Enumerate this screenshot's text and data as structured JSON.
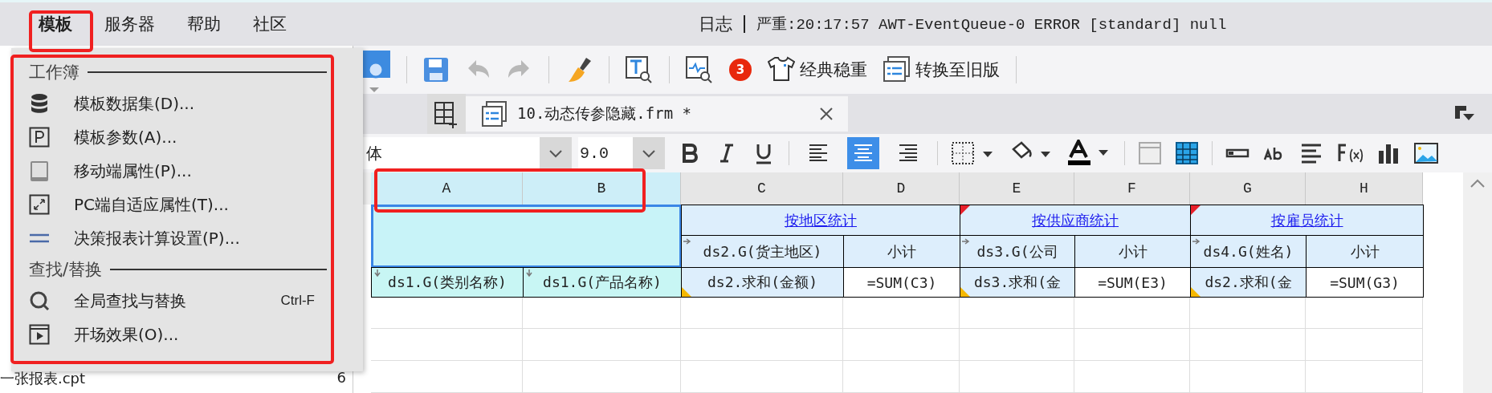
{
  "menubar": {
    "items": [
      {
        "label": "模板",
        "selected": true
      },
      {
        "label": "服务器",
        "selected": false
      },
      {
        "label": "帮助",
        "selected": false
      },
      {
        "label": "社区",
        "selected": false
      }
    ],
    "log_label": "日志",
    "log_text": "严重:20:17:57 AWT-EventQueue-0 ERROR [standard] null"
  },
  "menu": {
    "sections": [
      {
        "title": "工作簿",
        "items": [
          {
            "kind": "database",
            "label": "模板数据集(D)..."
          },
          {
            "kind": "param",
            "label": "模板参数(A)..."
          },
          {
            "kind": "tablet",
            "label": "移动端属性(P)..."
          },
          {
            "kind": "resize",
            "label": "PC端自适应属性(T)..."
          },
          {
            "kind": "lines",
            "label": "决策报表计算设置(P)..."
          }
        ]
      },
      {
        "title": "查找/替换",
        "items": [
          {
            "kind": "search",
            "label": "全局查找与替换",
            "shortcut": "Ctrl-F"
          },
          {
            "kind": "play",
            "label": "开场效果(O)..."
          }
        ]
      }
    ]
  },
  "left_panel": {
    "items": [
      {
        "name": "一张报表.cpt",
        "count": "6"
      }
    ]
  },
  "toolbar": {
    "badge": "3",
    "buttons": [
      {
        "kind": "shirt",
        "label": "经典稳重"
      },
      {
        "kind": "form",
        "label": "转换至旧版"
      }
    ]
  },
  "tabs": [
    {
      "label": "10.动态传参隐藏.frm *",
      "selected": true
    }
  ],
  "format_bar": {
    "font": "体",
    "size": "9.0",
    "align": [
      {
        "kind": "left",
        "selected": false
      },
      {
        "kind": "center",
        "selected": true
      },
      {
        "kind": "right",
        "selected": false
      }
    ]
  },
  "sheet": {
    "columns": [
      {
        "label": "A",
        "selected": true
      },
      {
        "label": "B",
        "selected": true
      },
      {
        "label": "C",
        "selected": false
      },
      {
        "label": "D",
        "selected": false
      },
      {
        "label": "E",
        "selected": false
      },
      {
        "label": "F",
        "selected": false
      },
      {
        "label": "G",
        "selected": false
      },
      {
        "label": "H",
        "selected": false
      }
    ],
    "cells": [
      {
        "kind": "selection",
        "expand_right": false,
        "expand_down": false
      },
      {
        "kind": "group",
        "text": "按地区统计",
        "expand_right": false,
        "expand_down": false
      },
      {
        "kind": "group",
        "text": "按供应商统计",
        "color": "#e8202a",
        "expand_right": false,
        "expand_down": false
      },
      {
        "kind": "group",
        "text": "按雇员统计",
        "color": "#e8202a",
        "expand_right": false,
        "expand_down": false
      },
      {
        "kind": "data",
        "text": "ds2.G(货主地区)",
        "expand_right": true,
        "expand_down": false
      },
      {
        "kind": "data",
        "text": "小计",
        "expand_right": false,
        "expand_down": false
      },
      {
        "kind": "data",
        "text": "ds3.G(公司",
        "expand_right": true,
        "expand_down": false
      },
      {
        "kind": "data",
        "text": "小计",
        "expand_right": false,
        "expand_down": false
      },
      {
        "kind": "data",
        "text": "ds4.G(姓名)",
        "expand_right": true,
        "expand_down": false
      },
      {
        "kind": "data",
        "text": "小计",
        "expand_right": false,
        "expand_down": false
      },
      {
        "kind": "key",
        "text": "ds1.G(类别名称)",
        "expand_right": false,
        "expand_down": true
      },
      {
        "kind": "key",
        "text": "ds1.G(产品名称)",
        "expand_right": false,
        "expand_down": true
      },
      {
        "kind": "data",
        "text": "ds2.求和(金额)",
        "color": "#f5b800",
        "expand_right": false,
        "expand_down": false
      },
      {
        "kind": "formula",
        "text": "=SUM(C3)",
        "expand_right": false,
        "expand_down": false
      },
      {
        "kind": "data",
        "text": "ds3.求和(金",
        "color": "#f5b800",
        "expand_right": false,
        "expand_down": false
      },
      {
        "kind": "formula",
        "text": "=SUM(E3)",
        "expand_right": false,
        "expand_down": false
      },
      {
        "kind": "data",
        "text": "ds2.求和(金",
        "color": "#f5b800",
        "expand_right": false,
        "expand_down": false
      },
      {
        "kind": "formula",
        "text": "=SUM(G3)",
        "expand_right": false,
        "expand_down": false
      }
    ]
  }
}
